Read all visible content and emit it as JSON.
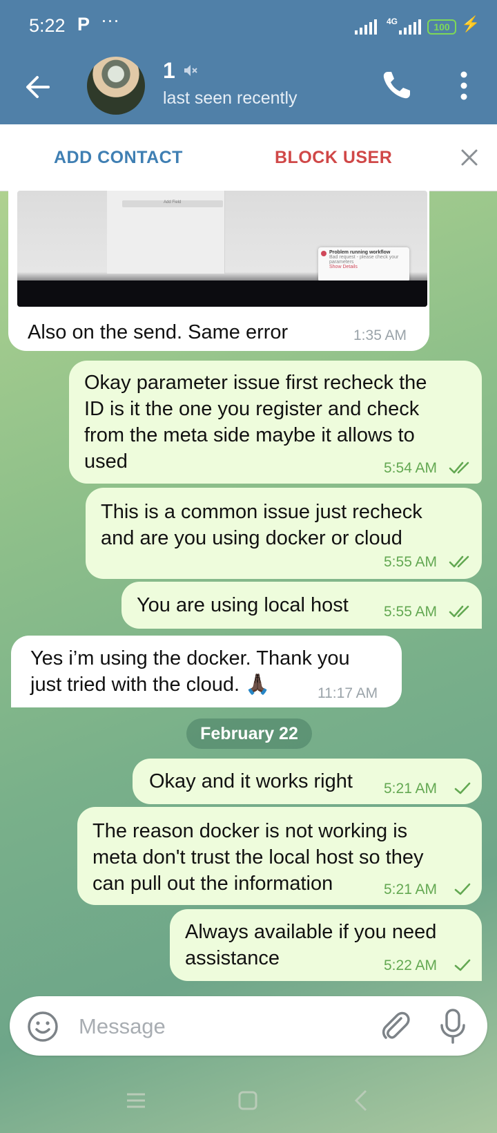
{
  "status_bar": {
    "time": "5:22",
    "p_icon": "P",
    "dots": "···",
    "network": "4G",
    "battery": "100"
  },
  "header": {
    "title": "1",
    "subtitle": "last seen recently",
    "icons": [
      "back-arrow-icon",
      "muted-icon",
      "phone-icon",
      "more-vertical-icon"
    ]
  },
  "action_bar": {
    "add_contact": "ADD CONTACT",
    "block_user": "BLOCK USER"
  },
  "media_caption": {
    "toast_title": "Problem running workflow",
    "toast_body": "Bad request - please check your parameters",
    "toast_link": "Show Details",
    "field_label": "Add Field"
  },
  "messages": [
    {
      "direction": "in",
      "text": "Also on the send. Same error",
      "time": "1:35 AM"
    },
    {
      "direction": "out",
      "text": "Okay parameter issue first recheck the\nID is it the one you register and check\nfrom the meta side maybe it allows to\nused",
      "time": "5:54 AM",
      "status": "read"
    },
    {
      "direction": "out",
      "text": "This is a common issue just recheck\nand are you using docker or cloud",
      "time": "5:55 AM",
      "status": "read"
    },
    {
      "direction": "out",
      "text": "You are using local host",
      "time": "5:55 AM",
      "status": "read"
    },
    {
      "direction": "in",
      "text": "Yes i’m using the docker. Thank you\njust tried with the cloud. 🙏🏿",
      "time": "11:17 AM"
    },
    {
      "direction": "out",
      "text": "Okay and it works right",
      "time": "5:21 AM",
      "status": "sent"
    },
    {
      "direction": "out",
      "text": "The reason docker is not working is\nmeta don't trust the local host so they\ncan pull out the information",
      "time": "5:21 AM",
      "status": "sent"
    },
    {
      "direction": "out",
      "text": "Always available if you need\nassistance",
      "time": "5:22 AM",
      "status": "sent"
    }
  ],
  "date_separator": "February 22",
  "composer": {
    "placeholder": "Message"
  },
  "colors": {
    "header": "#5080a8",
    "out_bubble": "#eefcdc",
    "in_bubble": "#ffffff",
    "add_contact": "#3f7fb3",
    "block_user": "#d04848",
    "check": "#63a852"
  }
}
